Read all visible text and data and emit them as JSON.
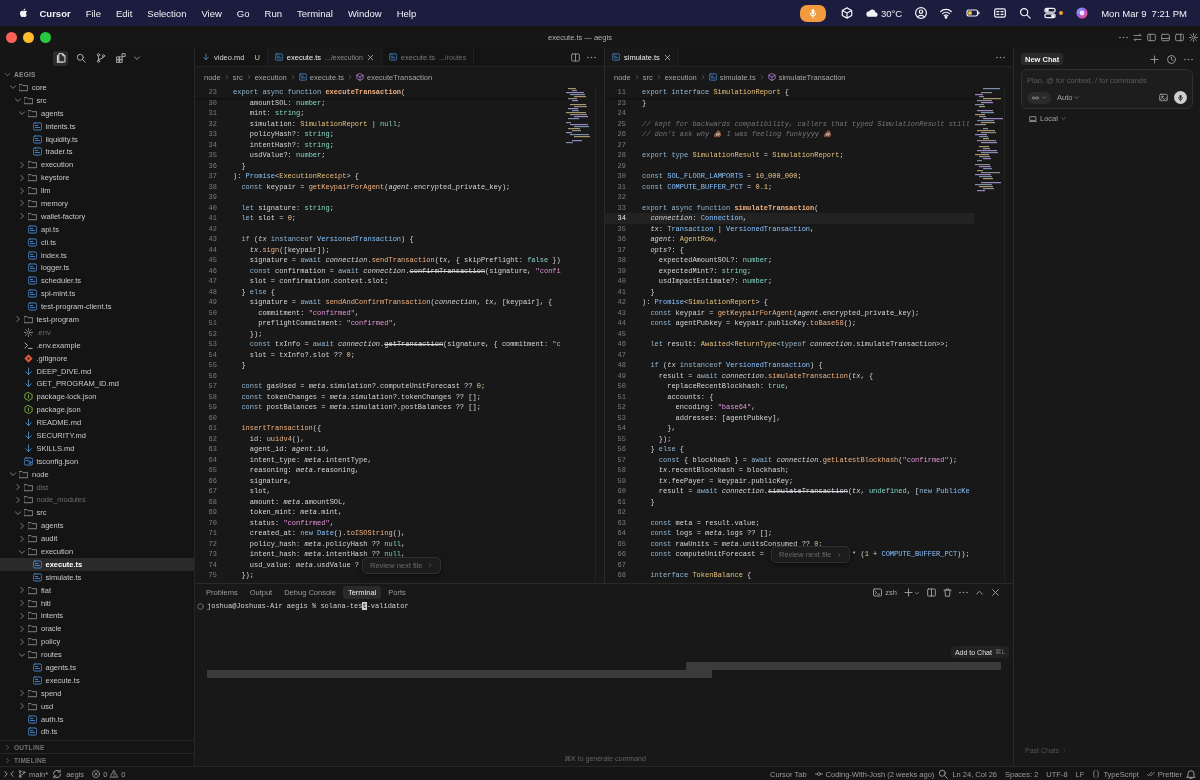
{
  "menu_bar": {
    "app": "Cursor",
    "menus": [
      "File",
      "Edit",
      "Selection",
      "View",
      "Go",
      "Run",
      "Terminal",
      "Window",
      "Help"
    ],
    "weather": "30°C",
    "date": "Mon Mar 9",
    "time": "7:21 PM"
  },
  "window": {
    "title": "execute.ts — aegis"
  },
  "explorer": {
    "views": [
      {
        "kind": "files",
        "selected": true
      },
      {
        "kind": "search",
        "selected": false
      },
      {
        "kind": "source_control",
        "selected": false
      },
      {
        "kind": "extensions",
        "selected": false
      }
    ],
    "title": "AEGIS",
    "expanded": true,
    "tree": [
      {
        "label": "core",
        "kind": "folder",
        "expanded": true,
        "selected": false,
        "dimmed": false,
        "children": [
          {
            "label": "src",
            "kind": "folder",
            "expanded": true,
            "selected": false,
            "dimmed": false,
            "children": [
              {
                "label": "agents",
                "kind": "folder",
                "expanded": true,
                "selected": false,
                "dimmed": false,
                "children": [
                  {
                    "label": "intents.ts",
                    "kind": "ts",
                    "selected": false,
                    "dimmed": false
                  },
                  {
                    "label": "liquidity.ts",
                    "kind": "ts",
                    "selected": false,
                    "dimmed": false
                  },
                  {
                    "label": "trader.ts",
                    "kind": "ts",
                    "selected": false,
                    "dimmed": false
                  }
                ]
              },
              {
                "label": "execution",
                "kind": "folder",
                "expanded": false,
                "selected": false,
                "dimmed": false
              },
              {
                "label": "keystore",
                "kind": "folder",
                "expanded": false,
                "selected": false,
                "dimmed": false
              },
              {
                "label": "llm",
                "kind": "folder",
                "expanded": false,
                "selected": false,
                "dimmed": false
              },
              {
                "label": "memory",
                "kind": "folder",
                "expanded": false,
                "selected": false,
                "dimmed": false
              },
              {
                "label": "wallet-factory",
                "kind": "folder",
                "expanded": false,
                "selected": false,
                "dimmed": false
              },
              {
                "label": "api.ts",
                "kind": "ts",
                "selected": false,
                "dimmed": false
              },
              {
                "label": "cli.ts",
                "kind": "ts",
                "selected": false,
                "dimmed": false
              },
              {
                "label": "index.ts",
                "kind": "ts",
                "selected": false,
                "dimmed": false
              },
              {
                "label": "logger.ts",
                "kind": "ts",
                "selected": false,
                "dimmed": false
              },
              {
                "label": "scheduler.ts",
                "kind": "ts",
                "selected": false,
                "dimmed": false
              },
              {
                "label": "spl-mint.ts",
                "kind": "ts",
                "selected": false,
                "dimmed": false
              },
              {
                "label": "test-program-client.ts",
                "kind": "ts",
                "selected": false,
                "dimmed": false
              }
            ]
          },
          {
            "label": "test-program",
            "kind": "folder",
            "expanded": false,
            "selected": false,
            "dimmed": false
          },
          {
            "label": ".env",
            "kind": "env",
            "selected": false,
            "dimmed": true
          },
          {
            "label": ".env.example",
            "kind": "shell",
            "selected": false,
            "dimmed": false
          },
          {
            "label": ".gitignore",
            "kind": "git",
            "selected": false,
            "dimmed": false
          },
          {
            "label": "DEEP_DIVE.md",
            "kind": "md",
            "selected": false,
            "dimmed": false
          },
          {
            "label": "GET_PROGRAM_ID.md",
            "kind": "md",
            "selected": false,
            "dimmed": false
          },
          {
            "label": "package-lock.json",
            "kind": "npm",
            "selected": false,
            "dimmed": false
          },
          {
            "label": "package.json",
            "kind": "npm",
            "selected": false,
            "dimmed": false
          },
          {
            "label": "README.md",
            "kind": "md",
            "selected": false,
            "dimmed": false
          },
          {
            "label": "SECURITY.md",
            "kind": "md",
            "selected": false,
            "dimmed": false
          },
          {
            "label": "SKILLS.md",
            "kind": "md",
            "selected": false,
            "dimmed": false
          },
          {
            "label": "tsconfig.json",
            "kind": "tsconfig",
            "selected": false,
            "dimmed": false
          }
        ]
      },
      {
        "label": "node",
        "kind": "folder",
        "expanded": true,
        "selected": false,
        "dimmed": false,
        "children": [
          {
            "label": "dist",
            "kind": "folder",
            "expanded": false,
            "selected": false,
            "dimmed": true
          },
          {
            "label": "node_modules",
            "kind": "folder",
            "expanded": false,
            "selected": false,
            "dimmed": true
          },
          {
            "label": "src",
            "kind": "folder",
            "expanded": true,
            "selected": false,
            "dimmed": false,
            "children": [
              {
                "label": "agents",
                "kind": "folder",
                "expanded": false,
                "selected": false,
                "dimmed": false
              },
              {
                "label": "audit",
                "kind": "folder",
                "expanded": false,
                "selected": false,
                "dimmed": false
              },
              {
                "label": "execution",
                "kind": "folder",
                "expanded": true,
                "selected": false,
                "dimmed": false,
                "children": [
                  {
                    "label": "execute.ts",
                    "kind": "ts",
                    "selected": true,
                    "dimmed": false
                  },
                  {
                    "label": "simulate.ts",
                    "kind": "ts",
                    "selected": false,
                    "dimmed": false
                  }
                ]
              },
              {
                "label": "fiat",
                "kind": "folder",
                "expanded": false,
                "selected": false,
                "dimmed": false
              },
              {
                "label": "hitl",
                "kind": "folder",
                "expanded": false,
                "selected": false,
                "dimmed": false
              },
              {
                "label": "intents",
                "kind": "folder",
                "expanded": false,
                "selected": false,
                "dimmed": false
              },
              {
                "label": "oracle",
                "kind": "folder",
                "expanded": false,
                "selected": false,
                "dimmed": false
              },
              {
                "label": "policy",
                "kind": "folder",
                "expanded": false,
                "selected": false,
                "dimmed": false
              },
              {
                "label": "routes",
                "kind": "folder",
                "expanded": true,
                "selected": false,
                "dimmed": false,
                "children": [
                  {
                    "label": "agents.ts",
                    "kind": "ts",
                    "selected": false,
                    "dimmed": false
                  },
                  {
                    "label": "execute.ts",
                    "kind": "ts",
                    "selected": false,
                    "dimmed": false
                  }
                ]
              },
              {
                "label": "spend",
                "kind": "folder",
                "expanded": false,
                "selected": false,
                "dimmed": false
              },
              {
                "label": "usd",
                "kind": "folder",
                "expanded": false,
                "selected": false,
                "dimmed": false
              },
              {
                "label": "auth.ts",
                "kind": "ts",
                "selected": false,
                "dimmed": false
              },
              {
                "label": "db.ts",
                "kind": "ts",
                "selected": false,
                "dimmed": false
              }
            ]
          }
        ]
      }
    ],
    "sections": [
      {
        "label": "OUTLINE",
        "expanded": false
      },
      {
        "label": "TIMELINE",
        "expanded": false
      }
    ]
  },
  "editors": [
    {
      "tabs": [
        {
          "label": "video.md",
          "kind": "md",
          "status": "U",
          "selected": false
        },
        {
          "label": "execute.ts",
          "kind": "ts",
          "description": ".../execution",
          "selected": true
        },
        {
          "label": "execute.ts",
          "kind": "ts",
          "description": ".../routes",
          "selected": false
        }
      ],
      "breadcrumbs": [
        {
          "label": "node",
          "kind": "folder"
        },
        {
          "label": "src",
          "kind": "folder"
        },
        {
          "label": "execution",
          "kind": "folder"
        },
        {
          "label": "execute.ts",
          "kind": "ts"
        },
        {
          "label": "executeTransaction",
          "kind": "symbol"
        }
      ],
      "sticky": {
        "n": "23",
        "code": [
          {
            "kw": "export async function "
          },
          {
            "def": "executeTransaction"
          },
          "("
        ]
      },
      "lines": [
        {
          "n": "30",
          "code": [
            "    amountSOL: ",
            {
              "prim": "number"
            },
            ";"
          ]
        },
        {
          "n": "31",
          "code": [
            "    mint: ",
            {
              "prim": "string"
            },
            ";"
          ]
        },
        {
          "n": "32",
          "code": [
            "    simulation: ",
            {
              "type": "SimulationReport"
            },
            " | ",
            {
              "prim": "null"
            },
            ";"
          ]
        },
        {
          "n": "33",
          "code": [
            "    policyHash?: ",
            {
              "prim": "string"
            },
            ";"
          ]
        },
        {
          "n": "34",
          "code": [
            "    intentHash?: ",
            {
              "prim": "string"
            },
            ";"
          ]
        },
        {
          "n": "35",
          "code": [
            "    usdValue?: ",
            {
              "prim": "number"
            },
            ";"
          ]
        },
        {
          "n": "36",
          "code": [
            "  }"
          ]
        },
        {
          "n": "37",
          "code": [
            "): ",
            {
              "cls": "Promise"
            },
            "<",
            {
              "type": "ExecutionReceipt"
            },
            "> {"
          ]
        },
        {
          "n": "38",
          "code": [
            {
              "kw": "  const"
            },
            " keypair = ",
            {
              "fn": "getKeypairForAgent"
            },
            "(",
            {
              "var": "agent"
            },
            ".encrypted_private_key);"
          ]
        },
        {
          "n": "39"
        },
        {
          "n": "40",
          "code": [
            {
              "kw": "  let"
            },
            " signature: ",
            {
              "prim": "string"
            },
            ";"
          ]
        },
        {
          "n": "41",
          "code": [
            {
              "kw": "  let"
            },
            " slot = ",
            {
              "num": "0"
            },
            ";"
          ]
        },
        {
          "n": "42"
        },
        {
          "n": "43",
          "code": [
            {
              "kw": "  if"
            },
            " (",
            {
              "var": "tx "
            },
            {
              "kw": "instanceof "
            },
            {
              "cls": "VersionedTransaction"
            },
            ") {"
          ]
        },
        {
          "n": "44",
          "code": [
            {
              "var": "    tx"
            },
            ".",
            {
              "fn": "sign"
            },
            "([keypair]);"
          ]
        },
        {
          "n": "45",
          "code": [
            "    signature = ",
            {
              "kw": "await "
            },
            {
              "var": "connection"
            },
            ".",
            {
              "fn": "sendTransaction"
            },
            "(",
            {
              "var": "tx"
            },
            ", { skipPreflight: ",
            {
              "prim": "false"
            },
            " })"
          ]
        },
        {
          "n": "46",
          "code": [
            {
              "kw": "    const"
            },
            " confirmation = ",
            {
              "kw": "await "
            },
            {
              "var": "connection"
            },
            ".",
            {
              "old": "confirmTransaction"
            },
            "(signature, ",
            {
              "str": "\"confi"
            }
          ]
        },
        {
          "n": "47",
          "code": [
            "    slot = confirmation.context.slot;"
          ]
        },
        {
          "n": "48",
          "code": [
            "  } ",
            {
              "kw": "else"
            },
            " {"
          ]
        },
        {
          "n": "49",
          "code": [
            "    signature = ",
            {
              "kw": "await "
            },
            {
              "fn": "sendAndConfirmTransaction"
            },
            "(",
            {
              "var": "connection"
            },
            ", ",
            {
              "var": "tx"
            },
            ", [keypair], {"
          ]
        },
        {
          "n": "50",
          "code": [
            "      commitment: ",
            {
              "str": "\"confirmed\""
            },
            ","
          ]
        },
        {
          "n": "51",
          "code": [
            "      preflightCommitment: ",
            {
              "str": "\"confirmed\""
            },
            ","
          ]
        },
        {
          "n": "52",
          "code": [
            "    });"
          ]
        },
        {
          "n": "53",
          "code": [
            {
              "kw": "    const"
            },
            " txInfo = ",
            {
              "kw": "await "
            },
            {
              "var": "connection"
            },
            ".",
            {
              "old": "getTransaction"
            },
            "(signature, { commitment: ",
            {
              "str": "\"c"
            }
          ]
        },
        {
          "n": "54",
          "code": [
            "    slot = txInfo?.slot ?? ",
            {
              "num": "0"
            },
            ";"
          ]
        },
        {
          "n": "55",
          "code": [
            "  }"
          ]
        },
        {
          "n": "56"
        },
        {
          "n": "57",
          "code": [
            {
              "kw": "  const"
            },
            " gasUsed = ",
            {
              "var": "meta"
            },
            ".simulation?.computeUnitForecast ?? ",
            {
              "num": "0"
            },
            ";"
          ]
        },
        {
          "n": "58",
          "code": [
            {
              "kw": "  const"
            },
            " tokenChanges = ",
            {
              "var": "meta"
            },
            ".simulation?.tokenChanges ?? [];"
          ]
        },
        {
          "n": "59",
          "code": [
            {
              "kw": "  const"
            },
            " postBalances = ",
            {
              "var": "meta"
            },
            ".simulation?.postBalances ?? [];"
          ]
        },
        {
          "n": "60"
        },
        {
          "n": "61",
          "code": [
            {
              "fn": "  insertTransaction"
            },
            "({"
          ]
        },
        {
          "n": "62",
          "code": [
            "    id: ",
            {
              "fn": "uuidv4"
            },
            "(),"
          ]
        },
        {
          "n": "63",
          "code": [
            "    agent_id: ",
            {
              "var": "agent"
            },
            ".id,"
          ]
        },
        {
          "n": "64",
          "code": [
            "    intent_type: ",
            {
              "var": "meta"
            },
            ".intentType,"
          ]
        },
        {
          "n": "65",
          "code": [
            "    reasoning: ",
            {
              "var": "meta"
            },
            ".reasoning,"
          ]
        },
        {
          "n": "66",
          "code": [
            "    signature,"
          ]
        },
        {
          "n": "67",
          "code": [
            "    slot,"
          ]
        },
        {
          "n": "68",
          "code": [
            "    amount: ",
            {
              "var": "meta"
            },
            ".amountSOL,"
          ]
        },
        {
          "n": "69",
          "code": [
            "    token_mint: ",
            {
              "var": "meta"
            },
            ".mint,"
          ]
        },
        {
          "n": "70",
          "code": [
            "    status: ",
            {
              "str": "\"confirmed\""
            },
            ","
          ]
        },
        {
          "n": "71",
          "code": [
            "    created_at: ",
            {
              "kw": "new "
            },
            {
              "cls": "Date"
            },
            "().",
            {
              "fn": "toISOString"
            },
            "(),"
          ]
        },
        {
          "n": "72",
          "code": [
            "    policy_hash: ",
            {
              "var": "meta"
            },
            ".policyHash ?? ",
            {
              "prim": "null"
            },
            ","
          ]
        },
        {
          "n": "73",
          "code": [
            "    intent_hash: ",
            {
              "var": "meta"
            },
            ".intentHash ?? ",
            {
              "prim": "null"
            },
            ","
          ]
        },
        {
          "n": "74",
          "code": [
            "    usd_value: ",
            {
              "var": "meta"
            },
            ".usdValue ?"
          ]
        },
        {
          "n": "75",
          "code": [
            "  });"
          ]
        }
      ],
      "review_button": "Review next file"
    },
    {
      "tabs": [
        {
          "label": "simulate.ts",
          "kind": "ts",
          "selected": true
        }
      ],
      "breadcrumbs": [
        {
          "label": "node",
          "kind": "folder"
        },
        {
          "label": "src",
          "kind": "folder"
        },
        {
          "label": "execution",
          "kind": "folder"
        },
        {
          "label": "simulate.ts",
          "kind": "ts"
        },
        {
          "label": "simulateTransaction",
          "kind": "symbol"
        }
      ],
      "sticky": {
        "n": "11",
        "code": [
          {
            "kw": "export interface "
          },
          {
            "type": "SimulationReport"
          },
          " {"
        ]
      },
      "lines": [
        {
          "n": "23",
          "code": [
            "}"
          ],
          "current": false
        },
        {
          "n": "24",
          "current": false
        },
        {
          "n": "25",
          "code": [
            {
              "cmt": "// kept for backwards compatibility, callers that typed SimulationResult still"
            }
          ],
          "current": false
        },
        {
          "n": "26",
          "code": [
            {
              "cmt": "// don't ask why 💩 I was feeling funkyyyy 💩"
            }
          ],
          "current": false
        },
        {
          "n": "27",
          "current": false
        },
        {
          "n": "28",
          "code": [
            {
              "kw": "export type "
            },
            {
              "type": "SimulationResult"
            },
            " = ",
            {
              "type": "SimulationReport"
            },
            ";"
          ],
          "current": false
        },
        {
          "n": "29",
          "current": false
        },
        {
          "n": "30",
          "code": [
            {
              "kw": "const "
            },
            {
              "cls": "SOL_FLOOR_LAMPORTS"
            },
            " = ",
            {
              "num": "10_000_000"
            },
            ";"
          ],
          "current": false
        },
        {
          "n": "31",
          "code": [
            {
              "kw": "const "
            },
            {
              "cls": "COMPUTE_BUFFER_PCT"
            },
            " = ",
            {
              "num": "0.1"
            },
            ";"
          ],
          "current": false
        },
        {
          "n": "32",
          "current": false
        },
        {
          "n": "33",
          "code": [
            {
              "kw": "export async function "
            },
            {
              "def": "simulateTransaction"
            },
            "("
          ],
          "current": false
        },
        {
          "n": "34",
          "code": [
            {
              "var": "  connection"
            },
            ": ",
            {
              "cls": "Connection"
            },
            ","
          ],
          "current": true
        },
        {
          "n": "35",
          "code": [
            {
              "var": "  tx"
            },
            ": ",
            {
              "cls": "Transaction"
            },
            " | ",
            {
              "cls": "VersionedTransaction"
            },
            ","
          ],
          "current": false
        },
        {
          "n": "36",
          "code": [
            {
              "var": "  agent"
            },
            ": ",
            {
              "type": "AgentRow"
            },
            ","
          ],
          "current": false
        },
        {
          "n": "37",
          "code": [
            {
              "var": "  opts"
            },
            "?: {"
          ],
          "current": false
        },
        {
          "n": "38",
          "code": [
            "    expectedAmountSOL?: ",
            {
              "prim": "number"
            },
            ";"
          ],
          "current": false
        },
        {
          "n": "39",
          "code": [
            "    expectedMint?: ",
            {
              "prim": "string"
            },
            ";"
          ],
          "current": false
        },
        {
          "n": "40",
          "code": [
            "    usdImpactEstimate?: ",
            {
              "prim": "number"
            },
            ";"
          ],
          "current": false
        },
        {
          "n": "41",
          "code": [
            "  }"
          ],
          "current": false
        },
        {
          "n": "42",
          "code": [
            "): ",
            {
              "cls": "Promise"
            },
            "<",
            {
              "type": "SimulationReport"
            },
            "> {"
          ],
          "current": false
        },
        {
          "n": "43",
          "code": [
            {
              "kw": "  const"
            },
            " keypair = ",
            {
              "fn": "getKeypairForAgent"
            },
            "(",
            {
              "var": "agent"
            },
            ".encrypted_private_key);"
          ],
          "current": false
        },
        {
          "n": "44",
          "code": [
            {
              "kw": "  const"
            },
            " agentPubkey = keypair.publicKey.",
            {
              "fn": "toBase58"
            },
            "();"
          ],
          "current": false
        },
        {
          "n": "45",
          "current": false
        },
        {
          "n": "46",
          "code": [
            {
              "kw": "  let"
            },
            " result: ",
            {
              "type": "Awaited"
            },
            "<",
            {
              "type": "ReturnType"
            },
            "<",
            {
              "kw": "typeof "
            },
            {
              "var": "connection"
            },
            ".simulateTransaction>>;"
          ],
          "current": false
        },
        {
          "n": "47",
          "current": false
        },
        {
          "n": "48",
          "code": [
            {
              "kw": "  if"
            },
            " (",
            {
              "var": "tx "
            },
            {
              "kw": "instanceof "
            },
            {
              "cls": "VersionedTransaction"
            },
            ") {"
          ],
          "current": false
        },
        {
          "n": "49",
          "code": [
            "    result = ",
            {
              "kw": "await "
            },
            {
              "var": "connection"
            },
            ".",
            {
              "fn": "simulateTransaction"
            },
            "(",
            {
              "var": "tx"
            },
            ", {"
          ],
          "current": false
        },
        {
          "n": "50",
          "code": [
            "      replaceRecentBlockhash: ",
            {
              "prim": "true"
            },
            ","
          ],
          "current": false
        },
        {
          "n": "51",
          "code": [
            "      accounts: {"
          ],
          "current": false
        },
        {
          "n": "52",
          "code": [
            "        encoding: ",
            {
              "str": "\"base64\""
            },
            ","
          ],
          "current": false
        },
        {
          "n": "53",
          "code": [
            "        addresses: [agentPubkey],"
          ],
          "current": false
        },
        {
          "n": "54",
          "code": [
            "      },"
          ],
          "current": false
        },
        {
          "n": "55",
          "code": [
            "    });"
          ],
          "current": false
        },
        {
          "n": "56",
          "code": [
            "  } ",
            {
              "kw": "else"
            },
            " {"
          ],
          "current": false
        },
        {
          "n": "57",
          "code": [
            {
              "kw": "    const"
            },
            " { blockhash } = ",
            {
              "kw": "await "
            },
            {
              "var": "connection"
            },
            ".",
            {
              "fn": "getLatestBlockhash"
            },
            "(",
            {
              "str": "\"confirmed\""
            },
            ");"
          ],
          "current": false
        },
        {
          "n": "58",
          "code": [
            {
              "var": "    tx"
            },
            ".recentBlockhash = blockhash;"
          ],
          "current": false
        },
        {
          "n": "59",
          "code": [
            {
              "var": "    tx"
            },
            ".feePayer = keypair.publicKey;"
          ],
          "current": false
        },
        {
          "n": "60",
          "code": [
            "    result = ",
            {
              "kw": "await "
            },
            {
              "var": "connection"
            },
            ".",
            {
              "old": "simulateTransaction"
            },
            "(",
            {
              "var": "tx"
            },
            ", ",
            {
              "prim": "undefined"
            },
            ", [",
            {
              "kw": "new "
            },
            {
              "cls": "PublicKe"
            }
          ],
          "current": false
        },
        {
          "n": "61",
          "code": [
            "  }"
          ],
          "current": false
        },
        {
          "n": "62",
          "current": false
        },
        {
          "n": "63",
          "code": [
            {
              "kw": "  const"
            },
            " meta = result.value;"
          ],
          "current": false
        },
        {
          "n": "64",
          "code": [
            {
              "kw": "  const"
            },
            " logs = ",
            {
              "var": "meta"
            },
            ".logs ?? [];"
          ],
          "current": false
        },
        {
          "n": "65",
          "code": [
            {
              "kw": "  const"
            },
            " rawUnits = ",
            {
              "var": "meta"
            },
            ".unitsConsumed ?? ",
            {
              "num": "0"
            },
            ";"
          ],
          "current": false
        },
        {
          "n": "66",
          "code": [
            {
              "kw": "  const"
            },
            " computeUnitForecast ="
          ],
          "tail": [
            "* (",
            {
              "num": "1"
            },
            " + ",
            {
              "cls": "COMPUTE_BUFFER_PCT"
            },
            "));"
          ],
          "current": false
        },
        {
          "n": "67",
          "current": false
        },
        {
          "n": "68",
          "code": [
            {
              "kw": "  interface "
            },
            {
              "type": "TokenBalance"
            },
            " {"
          ],
          "current": false
        }
      ],
      "review_button": "Review next file"
    }
  ],
  "terminal": {
    "tabs": [
      {
        "label": "Problems",
        "selected": false
      },
      {
        "label": "Output",
        "selected": false
      },
      {
        "label": "Debug Console",
        "selected": false
      },
      {
        "label": "Terminal",
        "selected": true
      },
      {
        "label": "Ports",
        "selected": false
      }
    ],
    "shell": "zsh",
    "prompt": "joshua@Joshuas-Air aegis %",
    "input": [
      {
        "text": "solana-tes",
        "cursor": false
      },
      {
        "text": "t",
        "cursor": true
      },
      {
        "text": "-validator",
        "cursor": false
      }
    ],
    "tooltip": {
      "label": "Add to Chat",
      "shortcut": "⌘L"
    },
    "hint": "⌘K to generate command"
  },
  "chat": {
    "tab": "New Chat",
    "placeholder": "Plan, @ for context, / for commands",
    "model": "Auto",
    "location": "Local",
    "footer": "Past Chats"
  },
  "status_bar": {
    "branch": "main*",
    "workspace": "aegis",
    "errors": "0",
    "warnings": "0",
    "mode": "Cursor Tab",
    "blame": "Coding-With-Josh (2 weeks ago)",
    "position": "Ln 24, Col 26",
    "indentation": "Spaces: 2",
    "encoding": "UTF-8",
    "line_ending": "LF",
    "language": "TypeScript",
    "formatter": "Prettier"
  }
}
